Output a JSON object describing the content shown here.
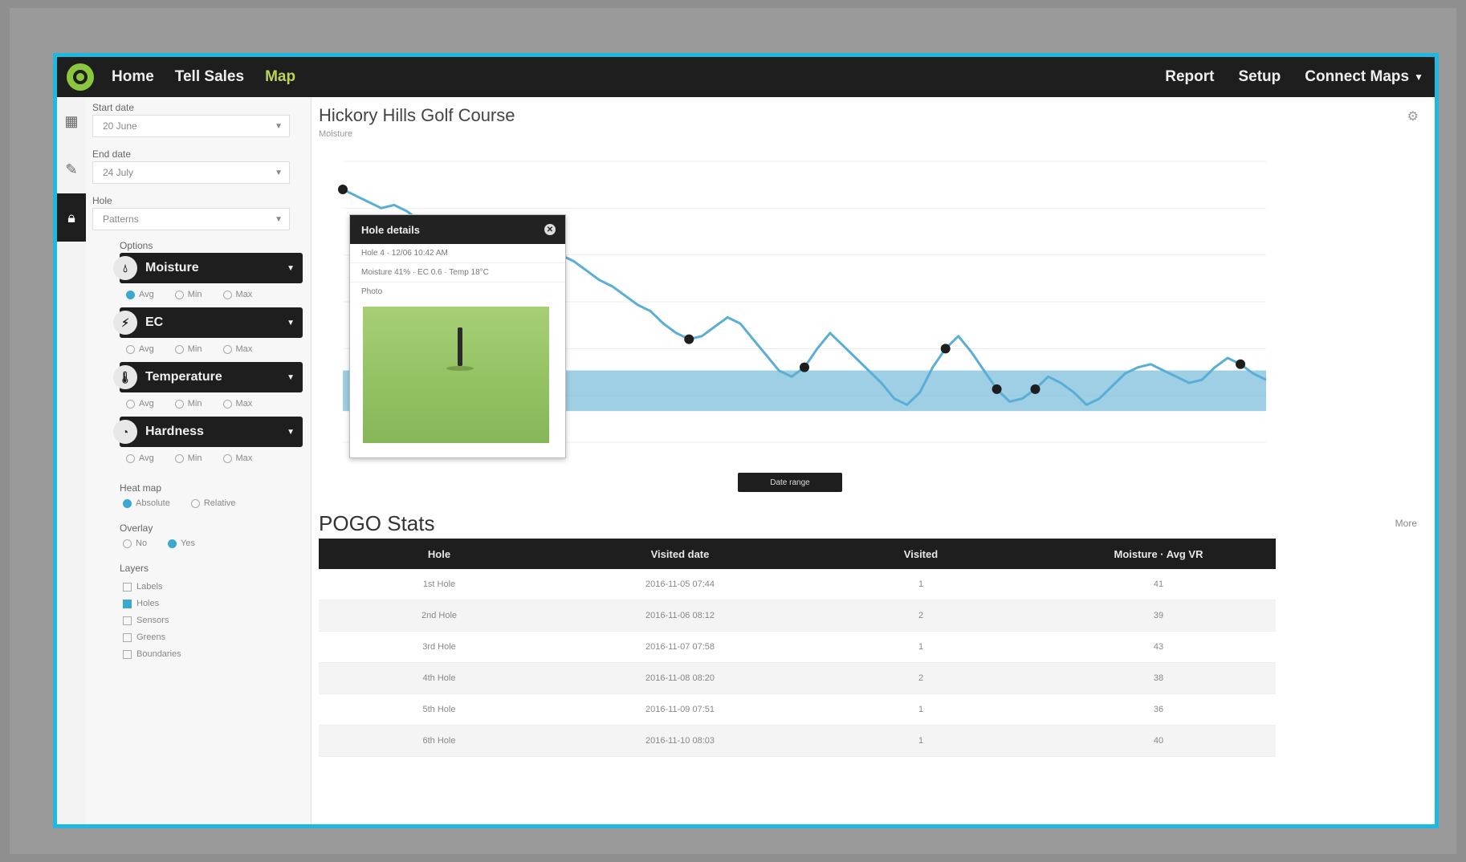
{
  "nav": {
    "items": [
      "Home",
      "Tell Sales",
      "Map"
    ],
    "right": [
      "Report",
      "Setup",
      "Connect Maps"
    ]
  },
  "sidebar": {
    "fields": [
      {
        "label": "Start date",
        "value": "20 June"
      },
      {
        "label": "End date",
        "value": "24 July"
      },
      {
        "label": "Hole",
        "value": "Patterns"
      }
    ],
    "metrics_label": "Options",
    "metrics": [
      {
        "label": "Moisture",
        "icon": "droplet-icon"
      },
      {
        "label": "EC",
        "icon": "bolt-icon"
      },
      {
        "label": "Temperature",
        "icon": "thermometer-icon"
      },
      {
        "label": "Hardness",
        "icon": "gauge-icon"
      }
    ],
    "metric_options": [
      "Avg",
      "Min",
      "Max"
    ],
    "heatmap_label": "Heat map",
    "heatmap_options": [
      "Absolute",
      "Relative"
    ],
    "overlay_label": "Overlay",
    "overlay_options": [
      "No",
      "Yes"
    ],
    "layers_label": "Layers",
    "layers": [
      "Labels",
      "Holes",
      "Sensors",
      "Greens",
      "Boundaries"
    ]
  },
  "chart": {
    "title": "Hickory Hills Golf Course",
    "subtitle": "Moisture",
    "date_button": "Date range",
    "line_color": "#5aaed6",
    "band_color": "#7fbfdc"
  },
  "chart_data": {
    "type": "line",
    "series": [
      {
        "values": [
          81,
          79,
          77,
          75,
          76,
          74,
          71,
          68,
          70,
          72,
          69,
          66,
          67,
          69,
          67,
          64,
          62,
          60,
          58,
          55,
          52,
          50,
          47,
          44,
          42,
          38,
          35,
          33,
          34,
          37,
          40,
          38,
          33,
          28,
          23,
          21,
          24,
          30,
          35,
          31,
          27,
          23,
          19,
          14,
          12,
          16,
          24,
          30,
          34,
          29,
          23,
          17,
          13,
          14,
          17,
          21,
          19,
          16,
          12,
          14,
          18,
          22,
          24,
          25,
          23,
          21,
          19,
          20,
          24,
          27,
          25,
          22,
          20
        ]
      }
    ],
    "target_band": [
      10,
      23
    ],
    "ylim": [
      0,
      90
    ]
  },
  "popup": {
    "title": "Hole details",
    "lines": [
      "Hole 4 · 12/06 10:42 AM",
      "Moisture 41% · EC 0.6 · Temp 18°C",
      "Photo"
    ]
  },
  "table": {
    "title": "POGO Stats",
    "link": "More",
    "headers": [
      "Hole",
      "Visited date",
      "Visited",
      "Moisture · Avg VR"
    ],
    "rows": [
      [
        "1st Hole",
        "2016-11-05 07:44",
        "1",
        "41"
      ],
      [
        "2nd Hole",
        "2016-11-06 08:12",
        "2",
        "39"
      ],
      [
        "3rd Hole",
        "2016-11-07 07:58",
        "1",
        "43"
      ],
      [
        "4th Hole",
        "2016-11-08 08:20",
        "2",
        "38"
      ],
      [
        "5th Hole",
        "2016-11-09 07:51",
        "1",
        "36"
      ],
      [
        "6th Hole",
        "2016-11-10 08:03",
        "1",
        "40"
      ]
    ]
  }
}
